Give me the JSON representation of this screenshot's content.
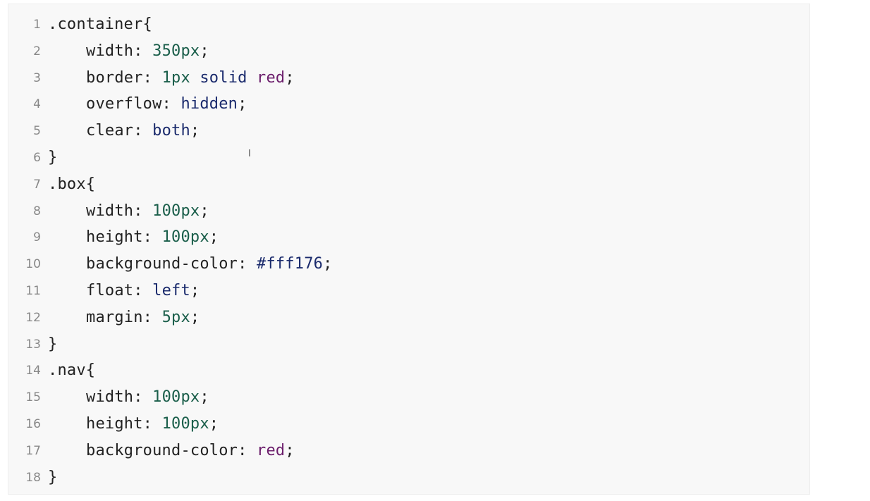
{
  "editor": {
    "lines": [
      {
        "n": "1",
        "parts": [
          {
            "t": ".container{",
            "c": ""
          }
        ]
      },
      {
        "n": "2",
        "indent": true,
        "parts": [
          {
            "t": "width: ",
            "c": ""
          },
          {
            "t": "350px",
            "c": "num"
          },
          {
            "t": ";",
            "c": ""
          }
        ]
      },
      {
        "n": "3",
        "indent": true,
        "parts": [
          {
            "t": "border: ",
            "c": ""
          },
          {
            "t": "1px",
            "c": "num"
          },
          {
            "t": " ",
            "c": ""
          },
          {
            "t": "solid",
            "c": "kw"
          },
          {
            "t": " ",
            "c": ""
          },
          {
            "t": "red",
            "c": "str"
          },
          {
            "t": ";",
            "c": ""
          }
        ]
      },
      {
        "n": "4",
        "indent": true,
        "parts": [
          {
            "t": "overflow: ",
            "c": ""
          },
          {
            "t": "hidden",
            "c": "kw"
          },
          {
            "t": ";",
            "c": ""
          }
        ]
      },
      {
        "n": "5",
        "indent": true,
        "parts": [
          {
            "t": "clear: ",
            "c": ""
          },
          {
            "t": "both",
            "c": "kw"
          },
          {
            "t": ";",
            "c": ""
          }
        ]
      },
      {
        "n": "6",
        "parts": [
          {
            "t": "}",
            "c": ""
          }
        ]
      },
      {
        "n": "7",
        "parts": [
          {
            "t": ".box{",
            "c": ""
          }
        ]
      },
      {
        "n": "8",
        "indent": true,
        "parts": [
          {
            "t": "width: ",
            "c": ""
          },
          {
            "t": "100px",
            "c": "num"
          },
          {
            "t": ";",
            "c": ""
          }
        ]
      },
      {
        "n": "9",
        "indent": true,
        "parts": [
          {
            "t": "height: ",
            "c": ""
          },
          {
            "t": "100px",
            "c": "num"
          },
          {
            "t": ";",
            "c": ""
          }
        ]
      },
      {
        "n": "10",
        "indent": true,
        "parts": [
          {
            "t": "background-color: ",
            "c": ""
          },
          {
            "t": "#fff176",
            "c": "hex"
          },
          {
            "t": ";",
            "c": ""
          }
        ]
      },
      {
        "n": "11",
        "indent": true,
        "parts": [
          {
            "t": "float: ",
            "c": ""
          },
          {
            "t": "left",
            "c": "kw"
          },
          {
            "t": ";",
            "c": ""
          }
        ]
      },
      {
        "n": "12",
        "indent": true,
        "parts": [
          {
            "t": "margin: ",
            "c": ""
          },
          {
            "t": "5px",
            "c": "num"
          },
          {
            "t": ";",
            "c": ""
          }
        ]
      },
      {
        "n": "13",
        "parts": [
          {
            "t": "}",
            "c": ""
          }
        ]
      },
      {
        "n": "14",
        "parts": [
          {
            "t": ".nav{",
            "c": ""
          }
        ]
      },
      {
        "n": "15",
        "indent": true,
        "parts": [
          {
            "t": "width: ",
            "c": ""
          },
          {
            "t": "100px",
            "c": "num"
          },
          {
            "t": ";",
            "c": ""
          }
        ]
      },
      {
        "n": "16",
        "indent": true,
        "parts": [
          {
            "t": "height: ",
            "c": ""
          },
          {
            "t": "100px",
            "c": "num"
          },
          {
            "t": ";",
            "c": ""
          }
        ]
      },
      {
        "n": "17",
        "indent": true,
        "parts": [
          {
            "t": "background-color: ",
            "c": ""
          },
          {
            "t": "red",
            "c": "str"
          },
          {
            "t": ";",
            "c": ""
          }
        ]
      },
      {
        "n": "18",
        "parts": [
          {
            "t": "}",
            "c": ""
          }
        ]
      }
    ]
  },
  "cursor": {
    "glyph": "I",
    "icon": "text-cursor-icon"
  },
  "colors": {
    "background": "#f8f8f8",
    "line_number": "#888888",
    "number": "#1a5e4a",
    "keyword": "#1a2a6c",
    "string": "#6b1d6b"
  }
}
